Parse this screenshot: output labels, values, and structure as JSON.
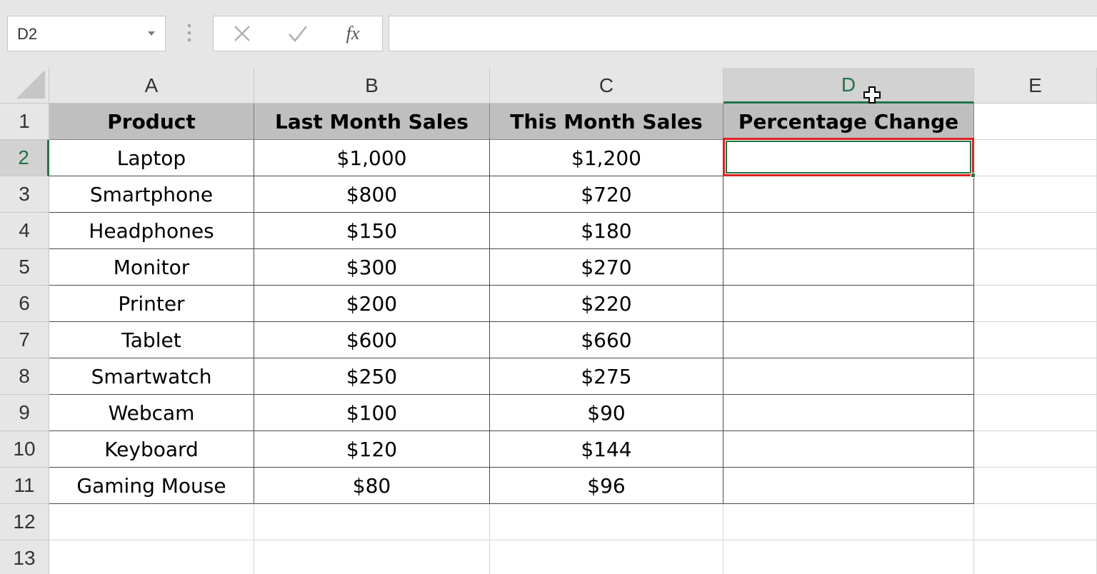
{
  "formula_bar": {
    "name_box": "D2",
    "formula": "",
    "icons": {
      "cancel": "close-icon",
      "enter": "check-icon",
      "function": "fx-icon"
    },
    "fx_label": "fx"
  },
  "grid": {
    "columns": [
      "A",
      "B",
      "C",
      "D",
      "E"
    ],
    "rows": [
      "1",
      "2",
      "3",
      "4",
      "5",
      "6",
      "7",
      "8",
      "9",
      "10",
      "11",
      "12",
      "13"
    ],
    "selected_column": "D",
    "selected_row": "2",
    "active_cell": "D2"
  },
  "table": {
    "headers": [
      "Product",
      "Last Month Sales",
      "This Month Sales",
      "Percentage Change"
    ],
    "rows": [
      [
        "Laptop",
        "$1,000",
        "$1,200",
        ""
      ],
      [
        "Smartphone",
        "$800",
        "$720",
        ""
      ],
      [
        "Headphones",
        "$150",
        "$180",
        ""
      ],
      [
        "Monitor",
        "$300",
        "$270",
        ""
      ],
      [
        "Printer",
        "$200",
        "$220",
        ""
      ],
      [
        "Tablet",
        "$600",
        "$660",
        ""
      ],
      [
        "Smartwatch",
        "$250",
        "$275",
        ""
      ],
      [
        "Webcam",
        "$100",
        "$90",
        ""
      ],
      [
        "Keyboard",
        "$120",
        "$144",
        ""
      ],
      [
        "Gaming Mouse",
        "$80",
        "$96",
        ""
      ]
    ]
  },
  "colors": {
    "selection_green": "#217346",
    "highlight_red": "#e02020",
    "header_fill": "#bfbfbf"
  },
  "cursor": "plus-cross-cursor-icon"
}
